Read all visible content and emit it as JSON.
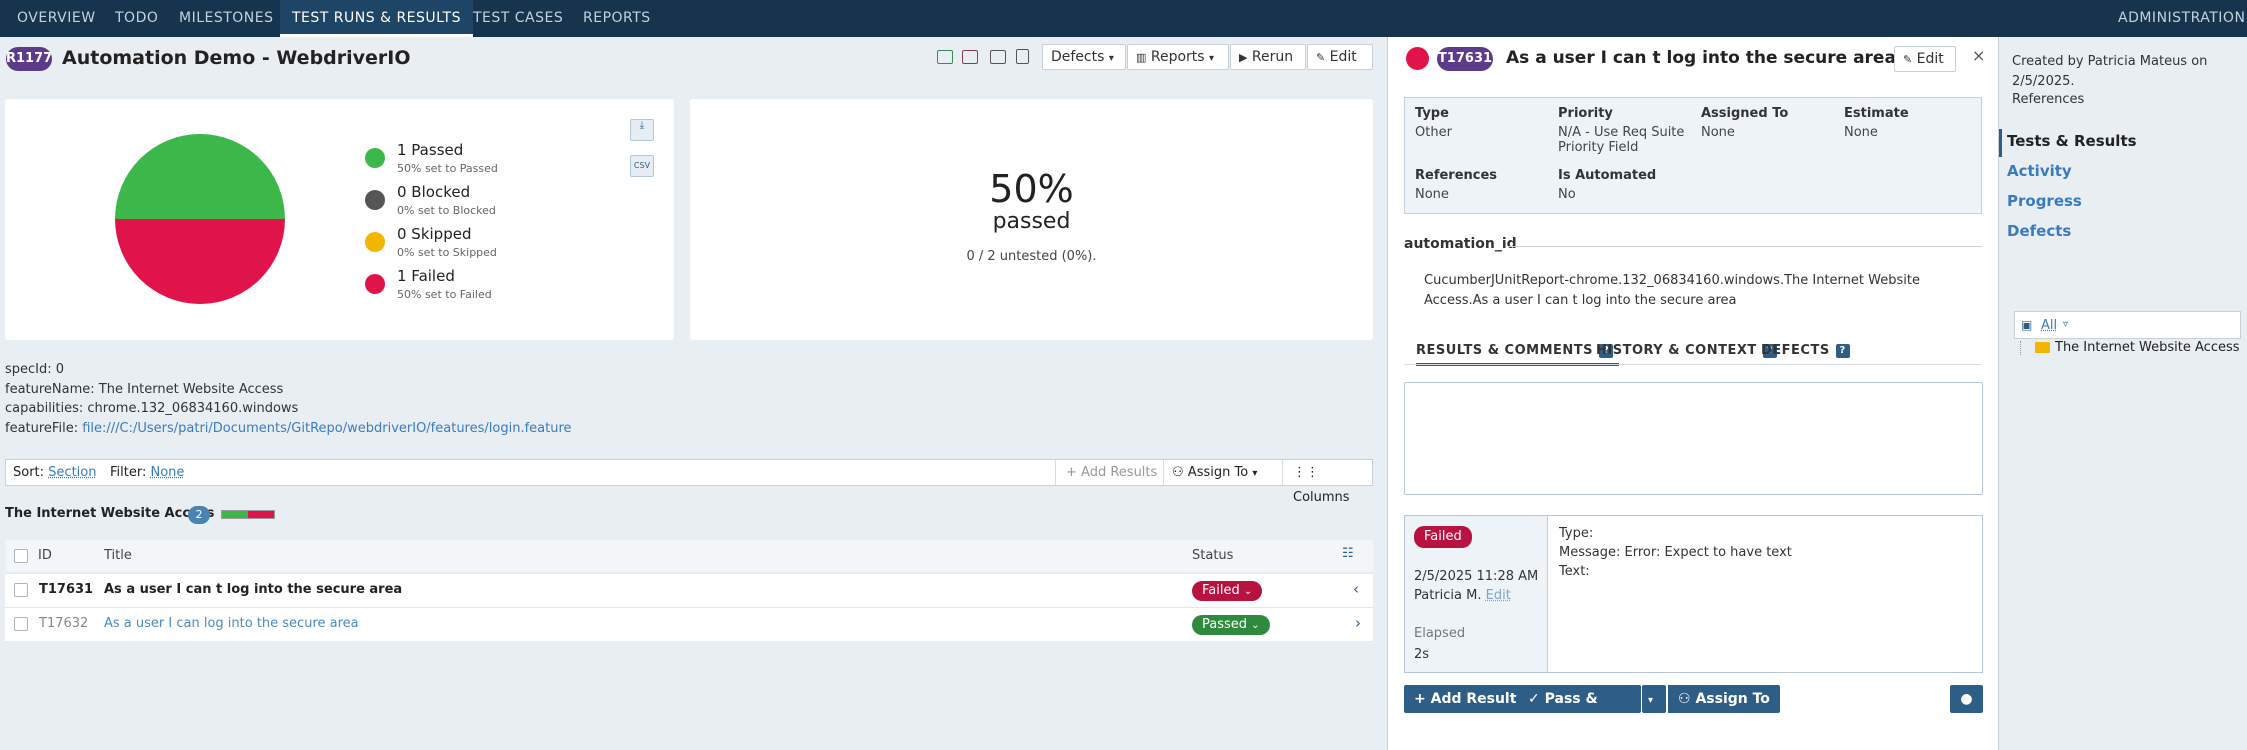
{
  "nav": {
    "tabs": [
      "OVERVIEW",
      "TODO",
      "MILESTONES",
      "TEST RUNS & RESULTS",
      "TEST CASES",
      "REPORTS"
    ],
    "admin": "ADMINISTRATION"
  },
  "run": {
    "id": "R1177",
    "title": "Automation Demo - WebdriverIO",
    "defects_label": "Defects",
    "reports_label": "Reports",
    "rerun_label": "Rerun",
    "edit_label": "Edit"
  },
  "stats": {
    "legend": [
      {
        "label": "1 Passed",
        "sub": "50% set to Passed",
        "color": "#3cb84a"
      },
      {
        "label": "0 Blocked",
        "sub": "0% set to Blocked",
        "color": "#555555"
      },
      {
        "label": "0 Skipped",
        "sub": "0% set to Skipped",
        "color": "#f3b600"
      },
      {
        "label": "1 Failed",
        "sub": "50% set to Failed",
        "color": "#e0144a"
      }
    ],
    "percent": "50%",
    "passed_word": "passed",
    "untested": "0 / 2 untested (0%)."
  },
  "chart_data": {
    "type": "pie",
    "categories": [
      "Passed",
      "Blocked",
      "Skipped",
      "Failed"
    ],
    "values": [
      50,
      0,
      0,
      50
    ],
    "colors": [
      "#3cb84a",
      "#555555",
      "#f3b600",
      "#e0144a"
    ]
  },
  "meta": {
    "specId": "specId: 0",
    "featureName": "featureName: The Internet Website Access",
    "capabilities": "capabilities: chrome.132_06834160.windows",
    "featureFile_label": "featureFile: ",
    "featureFile_link": "file:///C:/Users/patri/Documents/GitRepo/webdriverIO/features/login.feature"
  },
  "toolbar": {
    "sort_label": "Sort:",
    "sort_value": "Section",
    "filter_label": "Filter:",
    "filter_value": "None",
    "add_results": "Add Results",
    "assign_to": "Assign To",
    "columns": "Columns"
  },
  "section": {
    "title": "The Internet Website Access",
    "count": "2"
  },
  "table": {
    "headers": {
      "id": "ID",
      "title": "Title",
      "status": "Status"
    },
    "rows": [
      {
        "id": "T17631",
        "title": "As a user I can t log into the secure area",
        "status": "Failed",
        "status_color": "#b8123e"
      },
      {
        "id": "T17632",
        "title": "As a user I can log into the secure area",
        "status": "Passed",
        "status_color": "#2f8a3d"
      }
    ]
  },
  "detail": {
    "id": "T17631",
    "title": "As a user I can t log into the secure area",
    "edit_label": "Edit",
    "fields": {
      "type_label": "Type",
      "type_value": "Other",
      "priority_label": "Priority",
      "priority_value": "N/A - Use Req Suite Priority Field",
      "assigned_label": "Assigned To",
      "assigned_value": "None",
      "estimate_label": "Estimate",
      "estimate_value": "None",
      "references_label": "References",
      "references_value": "None",
      "automated_label": "Is Automated",
      "automated_value": "No"
    },
    "automation_id_label": "automation_id",
    "automation_id_value": "CucumberJUnitReport-chrome.132_06834160.windows.The Internet Website Access.As a user I can t log into the secure area",
    "subtabs": [
      "RESULTS & COMMENTS",
      "HISTORY & CONTEXT",
      "DEFECTS"
    ],
    "result": {
      "status": "Failed",
      "date": "2/5/2025 11:28 AM",
      "user": "Patricia M.",
      "edit": "Edit",
      "elapsed_label": "Elapsed",
      "elapsed_value": "2s",
      "type_line": "Type:",
      "message_line": "Message: Error: Expect  to have text",
      "text_line": "Text:"
    },
    "buttons": {
      "add_result": "Add Result",
      "pass_next": "Pass & Next",
      "assign_to": "Assign To"
    }
  },
  "sidebar": {
    "created": "Created by Patricia Mateus on 2/5/2025.",
    "references": "References",
    "links": [
      "Tests & Results",
      "Activity",
      "Progress",
      "Defects"
    ],
    "filter_all": "All",
    "tree_item": "The Internet Website Access"
  }
}
